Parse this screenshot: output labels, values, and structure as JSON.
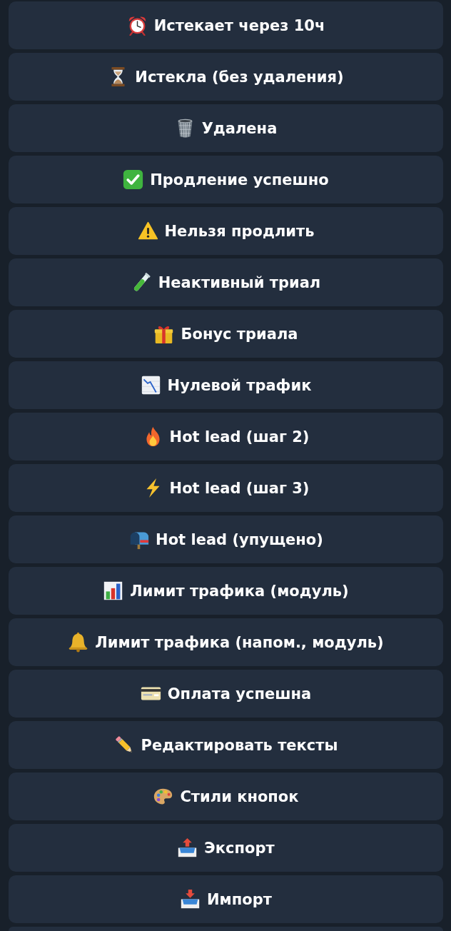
{
  "keyboard": {
    "buttons": [
      {
        "kind": "alarm",
        "label": "Истекает через 10ч"
      },
      {
        "kind": "hourglass",
        "label": "Истекла (без удаления)"
      },
      {
        "kind": "trash",
        "label": "Удалена"
      },
      {
        "kind": "check",
        "label": "Продление успешно"
      },
      {
        "kind": "warning",
        "label": "Нельзя продлить"
      },
      {
        "kind": "testtube",
        "label": "Неактивный триал"
      },
      {
        "kind": "gift",
        "label": "Бонус триала"
      },
      {
        "kind": "decline",
        "label": "Нулевой трафик"
      },
      {
        "kind": "fire",
        "label": "Hot lead (шаг 2)"
      },
      {
        "kind": "bolt",
        "label": "Hot lead (шаг 3)"
      },
      {
        "kind": "mailbox",
        "label": "Hot lead (упущено)"
      },
      {
        "kind": "chart",
        "label": "Лимит трафика (модуль)"
      },
      {
        "kind": "bell",
        "label": "Лимит трафика (напом., модуль)"
      },
      {
        "kind": "card",
        "label": "Оплата успешна"
      },
      {
        "kind": "pencil",
        "label": "Редактировать тексты"
      },
      {
        "kind": "palette",
        "label": "Стили кнопок"
      },
      {
        "kind": "outbox",
        "label": "Экспорт"
      },
      {
        "kind": "inbox",
        "label": "Импорт"
      }
    ],
    "next_button_partly_visible": true
  }
}
